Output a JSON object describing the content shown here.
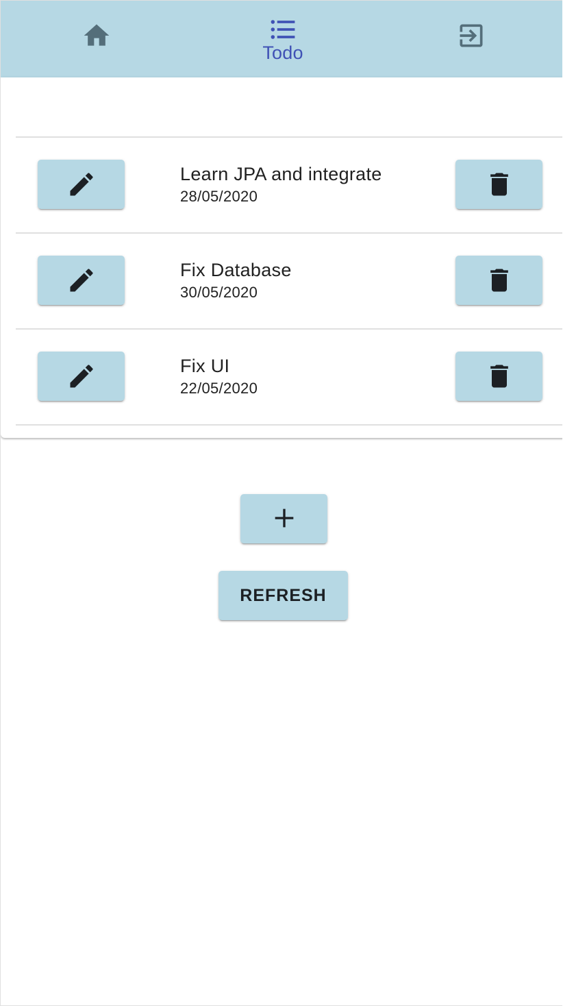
{
  "nav": {
    "items": [
      {
        "icon": "home-icon",
        "label": ""
      },
      {
        "icon": "list-icon",
        "label": "Todo"
      },
      {
        "icon": "exit-icon",
        "label": ""
      }
    ],
    "active_color": "#3f51b5",
    "inactive_color": "#546e7a",
    "background": "#b6d8e4"
  },
  "todos": [
    {
      "title": "Learn JPA and integrate",
      "date": "28/05/2020"
    },
    {
      "title": "Fix Database",
      "date": "30/05/2020"
    },
    {
      "title": "Fix UI",
      "date": "22/05/2020"
    }
  ],
  "actions": {
    "add_icon": "plus-icon",
    "refresh_label": "REFRESH"
  },
  "colors": {
    "button_bg": "#b6d8e4",
    "icon_dark": "#1c2024"
  }
}
